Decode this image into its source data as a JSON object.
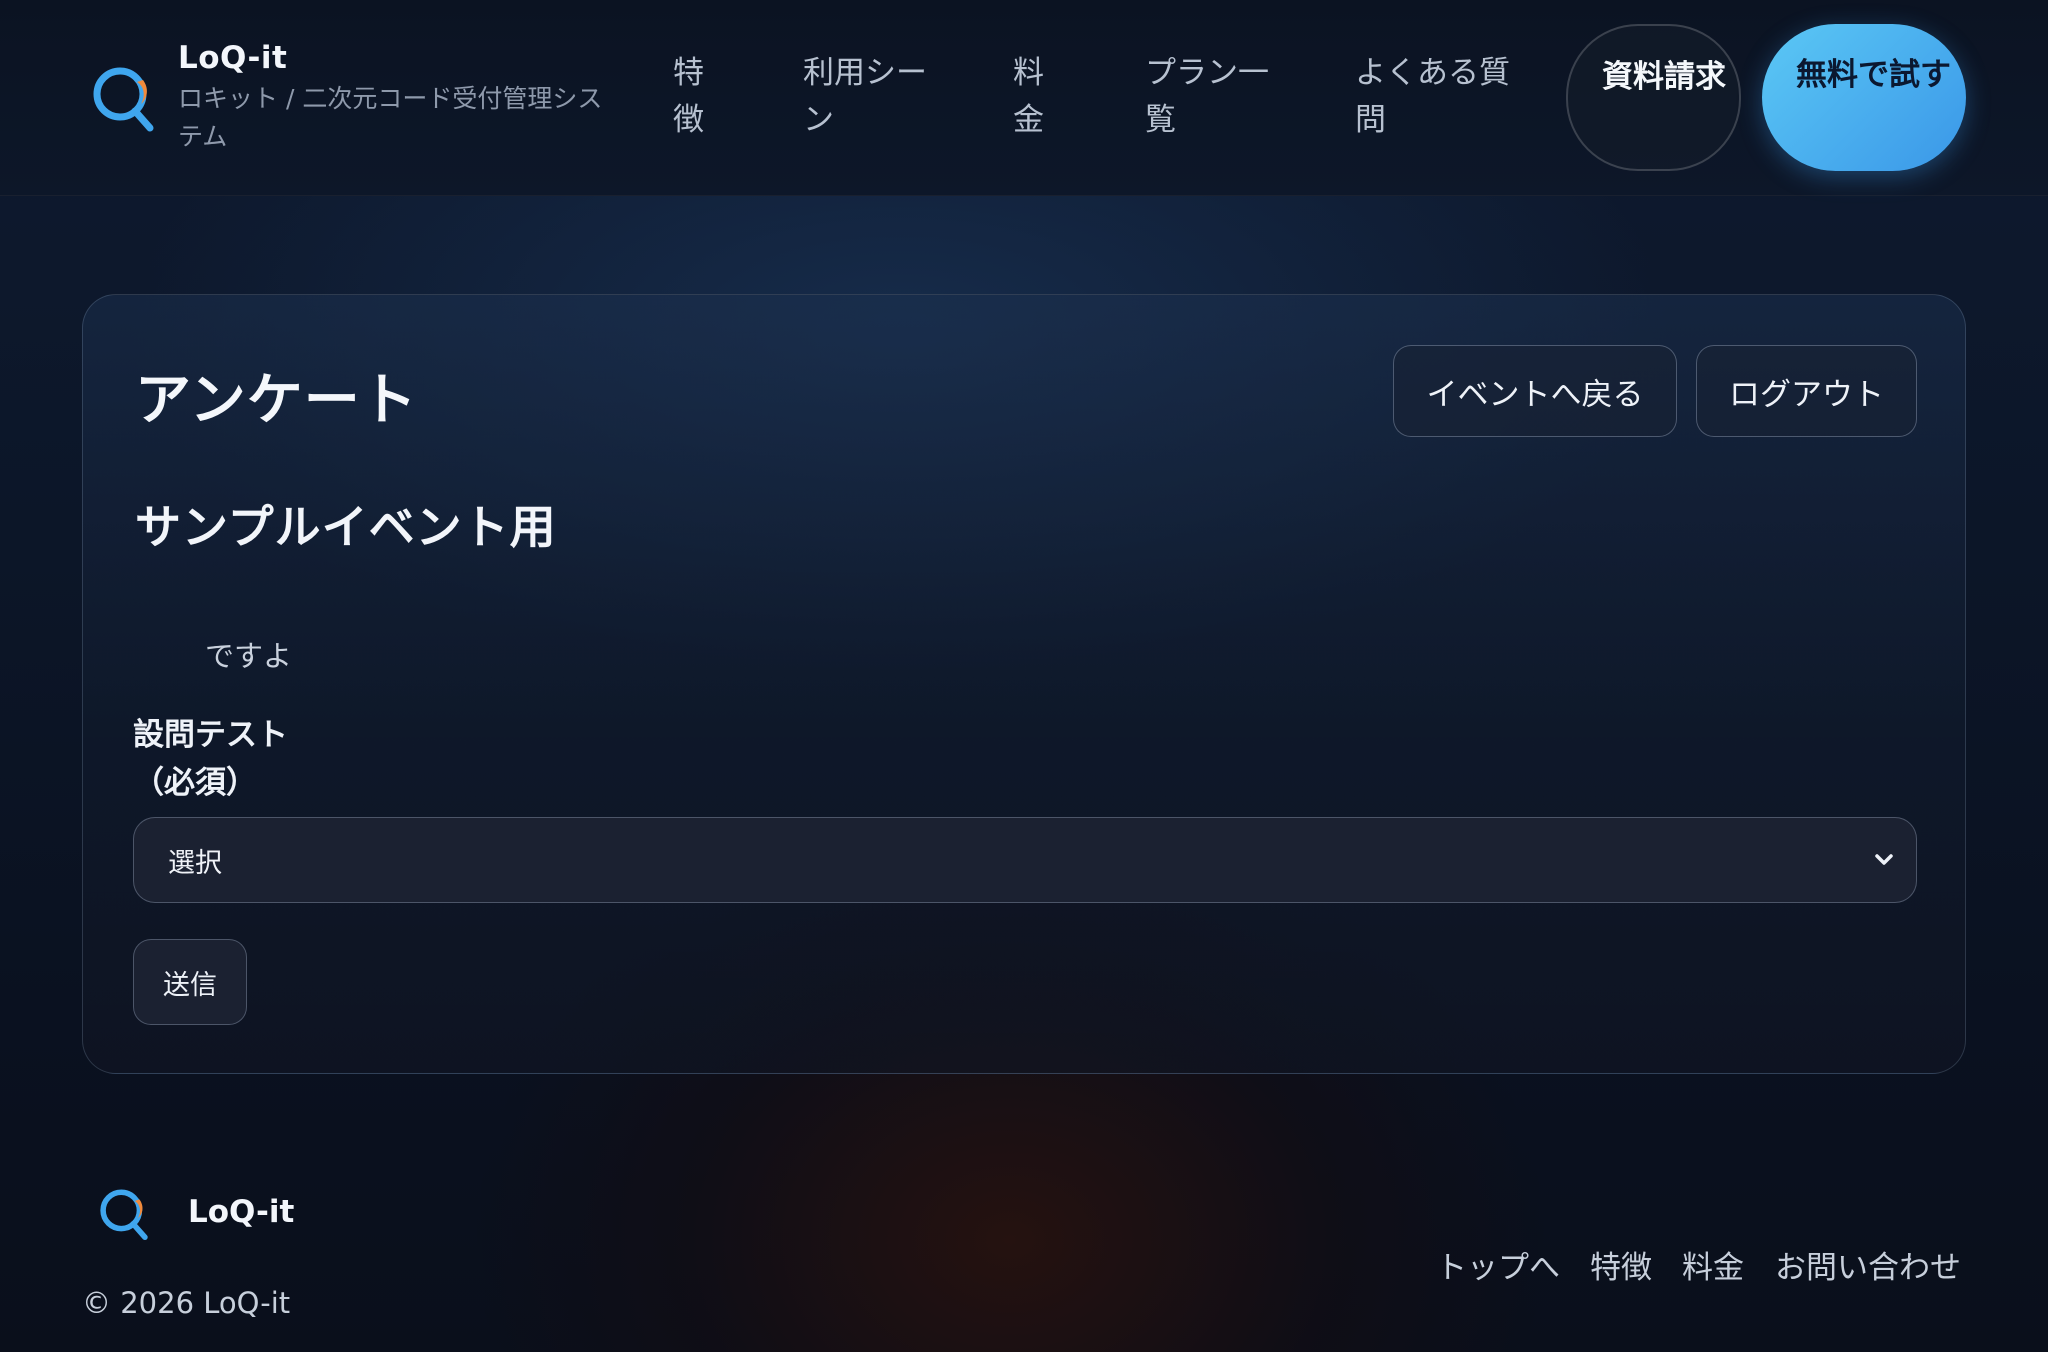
{
  "header": {
    "brand_name": "LoQ-it",
    "brand_sub": "ロキット / 二次元コード受付管理システム",
    "nav": [
      "特徴",
      "利用シーン",
      "料金",
      "プラン一覧",
      "よくある質問"
    ],
    "request_docs_label": "資料請求",
    "free_trial_label": "無料で試す"
  },
  "card": {
    "title": "アンケート",
    "back_label": "イベントへ戻る",
    "logout_label": "ログアウト",
    "subtitle": "サンプルイベント用",
    "description": "ですよ",
    "question_label": "設問テスト（必須）",
    "select_value": "選択",
    "submit_label": "送信"
  },
  "footer": {
    "brand_name": "LoQ-it",
    "copyright": "© 2026 LoQ-it",
    "links": [
      "トップへ",
      "特徴",
      "料金",
      "お問い合わせ"
    ]
  },
  "colors": {
    "accent_blue": "#3a97e8",
    "accent_light_blue": "#5bc8f5",
    "logo_orange": "#f08a3c"
  },
  "icons": {
    "logo": "magnifier-q-logo-icon",
    "select": "chevron-down-icon"
  }
}
